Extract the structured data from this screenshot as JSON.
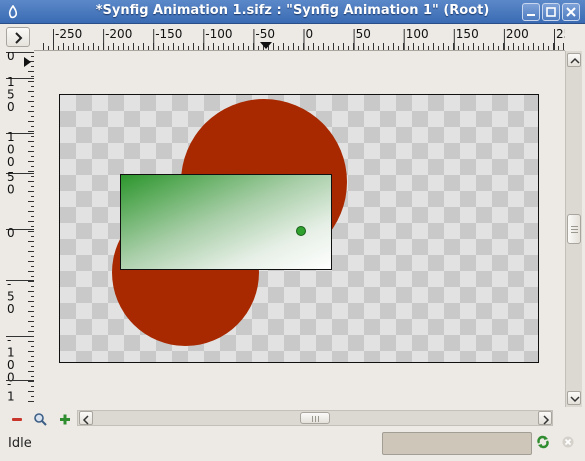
{
  "window": {
    "title": "*Synfig Animation 1.sifz : \"Synfig Animation 1\" (Root)",
    "icons": [
      "synfig-app-icon",
      "minimize-icon",
      "maximize-icon",
      "close-icon"
    ]
  },
  "rulers": {
    "corner_icon": "chevron-right-icon",
    "horizontal_labels": [
      "-250",
      "-200",
      "-150",
      "-100",
      "-50",
      "0",
      "50",
      "100",
      "150",
      "200",
      "25"
    ],
    "vertical_labels": [
      [
        "0"
      ],
      [
        "1",
        "5",
        "0"
      ],
      [
        "1",
        "0",
        "0"
      ],
      [
        "5",
        "0"
      ],
      [
        "0"
      ],
      [
        "-",
        "5",
        "0"
      ],
      [
        "-",
        "1",
        "0",
        "0"
      ],
      [
        "-",
        "1"
      ]
    ],
    "time_cursor_icon": "triangle-marker-icon"
  },
  "canvas": {
    "background_check_light": "#e2e2e2",
    "background_check_dark": "#c9c9c9",
    "circle_color": "#a82900",
    "gradient_start": "#2c962c",
    "gradient_end": "#ffffff",
    "duck_color": "#2fa12f"
  },
  "toolbar": {
    "zoom_out_icon": "minus-icon",
    "zoom_fit_icon": "magnifier-icon",
    "zoom_in_icon": "plus-icon"
  },
  "status": {
    "text": "Idle",
    "refresh_icon": "refresh-icon",
    "stop_icon": "stop-icon"
  }
}
